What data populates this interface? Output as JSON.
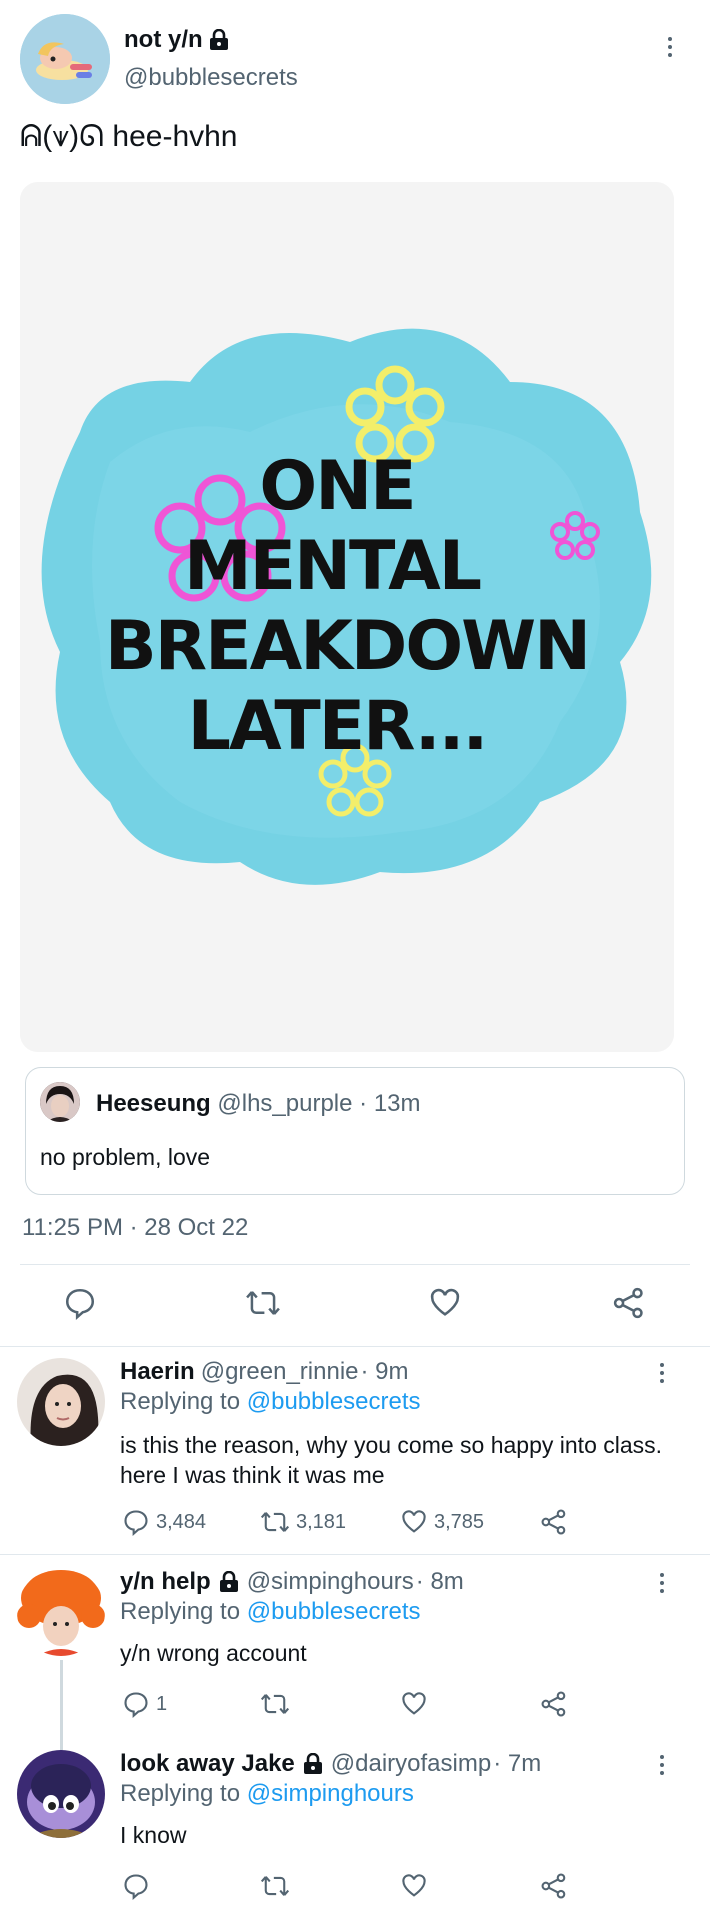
{
  "main_tweet": {
    "display_name": "not y/n",
    "handle": "@bubblesecrets",
    "text": "ᕱ(⩛)ᘏ hee-hvhn",
    "image_caption_lines": [
      "ONE",
      "MENTAL",
      "BREAKDOWN",
      "LATER..."
    ],
    "timestamp": "11:25 PM · 28 Oct 22"
  },
  "quoted_tweet": {
    "display_name": "Heeseung",
    "handle": "@lhs_purple",
    "age": "· 13m",
    "text": "no problem, love"
  },
  "replies": [
    {
      "display_name": "Haerin",
      "handle": "@green_rinnie",
      "age": "· 9m",
      "replying_label": "Replying to",
      "replying_to": "@bubblesecrets",
      "text": "is this the reason, why you come so happy into class. here I was think it was me",
      "reply_count": "3,484",
      "retweet_count": "3,181",
      "like_count": "3,785"
    },
    {
      "display_name": "y/n help",
      "handle": "@simpinghours",
      "age": "· 8m",
      "replying_label": "Replying to",
      "replying_to": "@bubblesecrets",
      "text": "y/n wrong account",
      "reply_count": "1",
      "retweet_count": "",
      "like_count": ""
    },
    {
      "display_name": "look away Jake",
      "handle": "@dairyofasimp",
      "age": "· 7m",
      "replying_label": "Replying to",
      "replying_to": "@simpinghours",
      "text": "I know",
      "reply_count": "",
      "retweet_count": "",
      "like_count": ""
    }
  ],
  "icons": [
    "lock-icon",
    "more-icon",
    "reply-icon",
    "retweet-icon",
    "like-icon",
    "share-icon"
  ],
  "colors": {
    "link": "#1d9bf0",
    "muted": "#536471",
    "text": "#0f1419",
    "divider": "#e1e8ed"
  }
}
